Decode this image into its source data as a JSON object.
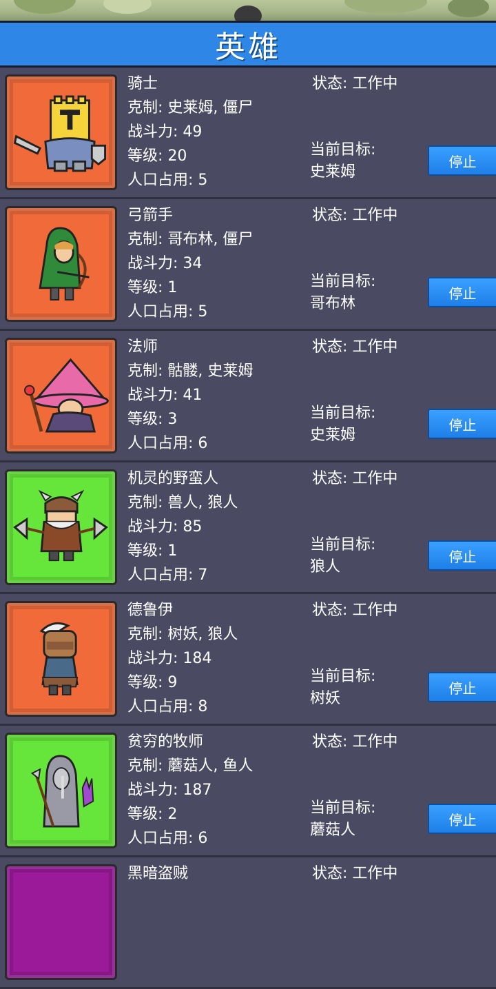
{
  "header": {
    "title": "英雄"
  },
  "labels": {
    "counter_prefix": "克制: ",
    "power_prefix": "战斗力: ",
    "level_prefix": "等级: ",
    "pop_prefix": "人口占用: ",
    "status_prefix": "状态: ",
    "target_label": "当前目标:"
  },
  "colors": {
    "title_bar": "#2e86e6",
    "row_bg": "#4a4a63",
    "portrait_orange": "#f06a3a",
    "portrait_green": "#66e63a",
    "portrait_purple": "#9a1a9a",
    "button": "#2e8ef0"
  },
  "heroes": [
    {
      "name": "骑士",
      "counter": "史莱姆, 僵尸",
      "power": "49",
      "level": "20",
      "population": "5",
      "status": "工作中",
      "target": "史莱姆",
      "button": "停止",
      "portrait_color": "#f06a3a",
      "icon": "knight-icon"
    },
    {
      "name": "弓箭手",
      "counter": "哥布林, 僵尸",
      "power": "34",
      "level": "1",
      "population": "5",
      "status": "工作中",
      "target": "哥布林",
      "button": "停止",
      "portrait_color": "#f06a3a",
      "icon": "archer-icon"
    },
    {
      "name": "法师",
      "counter": "骷髅, 史莱姆",
      "power": "41",
      "level": "3",
      "population": "6",
      "status": "工作中",
      "target": "史莱姆",
      "button": "停止",
      "portrait_color": "#f06a3a",
      "icon": "mage-icon"
    },
    {
      "name": "机灵的野蛮人",
      "counter": "兽人, 狼人",
      "power": "85",
      "level": "1",
      "population": "7",
      "status": "工作中",
      "target": "狼人",
      "button": "停止",
      "portrait_color": "#66e63a",
      "icon": "barbarian-icon"
    },
    {
      "name": "德鲁伊",
      "counter": "树妖, 狼人",
      "power": "184",
      "level": "9",
      "population": "8",
      "status": "工作中",
      "target": "树妖",
      "button": "停止",
      "portrait_color": "#f06a3a",
      "icon": "druid-icon"
    },
    {
      "name": "贫穷的牧师",
      "counter": "蘑菇人, 鱼人",
      "power": "187",
      "level": "2",
      "population": "6",
      "status": "工作中",
      "target": "蘑菇人",
      "button": "停止",
      "portrait_color": "#66e63a",
      "icon": "priest-icon"
    },
    {
      "name": "黑暗盗贼",
      "status": "工作中",
      "portrait_color": "#9a1a9a",
      "icon": "rogue-icon"
    }
  ]
}
